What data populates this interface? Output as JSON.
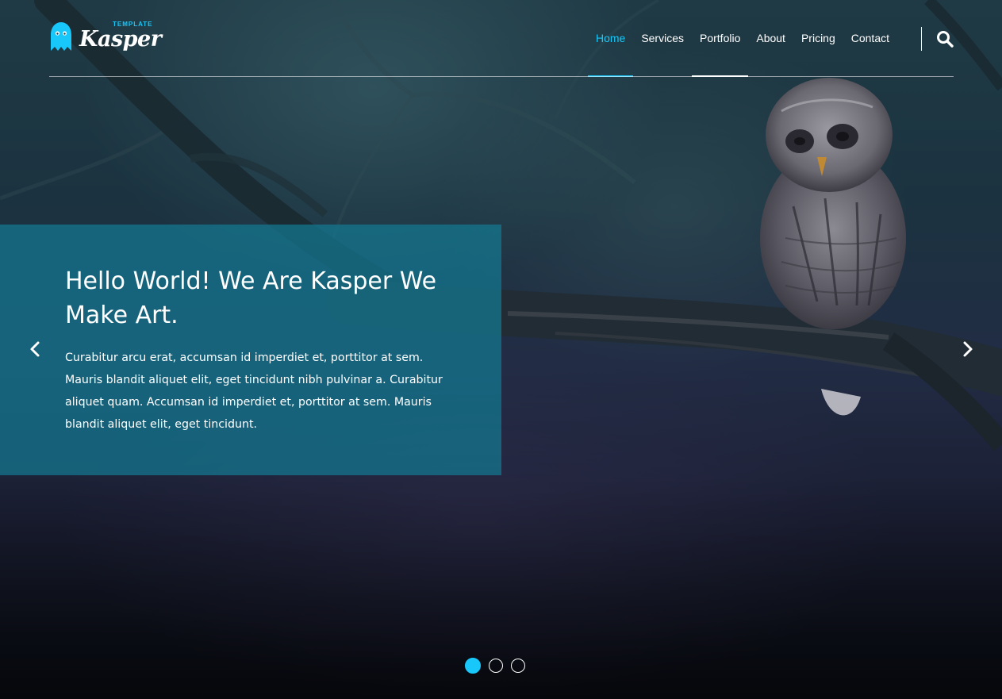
{
  "brand": {
    "name": "Kasper",
    "tagline": "TEMPLATE",
    "accent_color": "#19c8fa"
  },
  "nav": {
    "items": [
      {
        "label": "Home",
        "state": "active"
      },
      {
        "label": "Services",
        "state": "normal"
      },
      {
        "label": "Portfolio",
        "state": "hover"
      },
      {
        "label": "About",
        "state": "normal"
      },
      {
        "label": "Pricing",
        "state": "normal"
      },
      {
        "label": "Contact",
        "state": "normal"
      }
    ],
    "search_icon": "search-icon"
  },
  "hero": {
    "title": "Hello World! We Are Kasper We Make Art.",
    "text": "Curabitur arcu erat, accumsan id imperdiet et, porttitor at sem. Mauris blandit aliquet elit, eget tincidunt nibh pulvinar a. Curabitur aliquet quam. Accumsan id imperdiet et, porttitor at sem. Mauris blandit aliquet elit, eget tincidunt.",
    "panel_color": "#147892",
    "prev_icon": "chevron-left-icon",
    "next_icon": "chevron-right-icon",
    "slides": {
      "count": 3,
      "active_index": 0
    }
  }
}
